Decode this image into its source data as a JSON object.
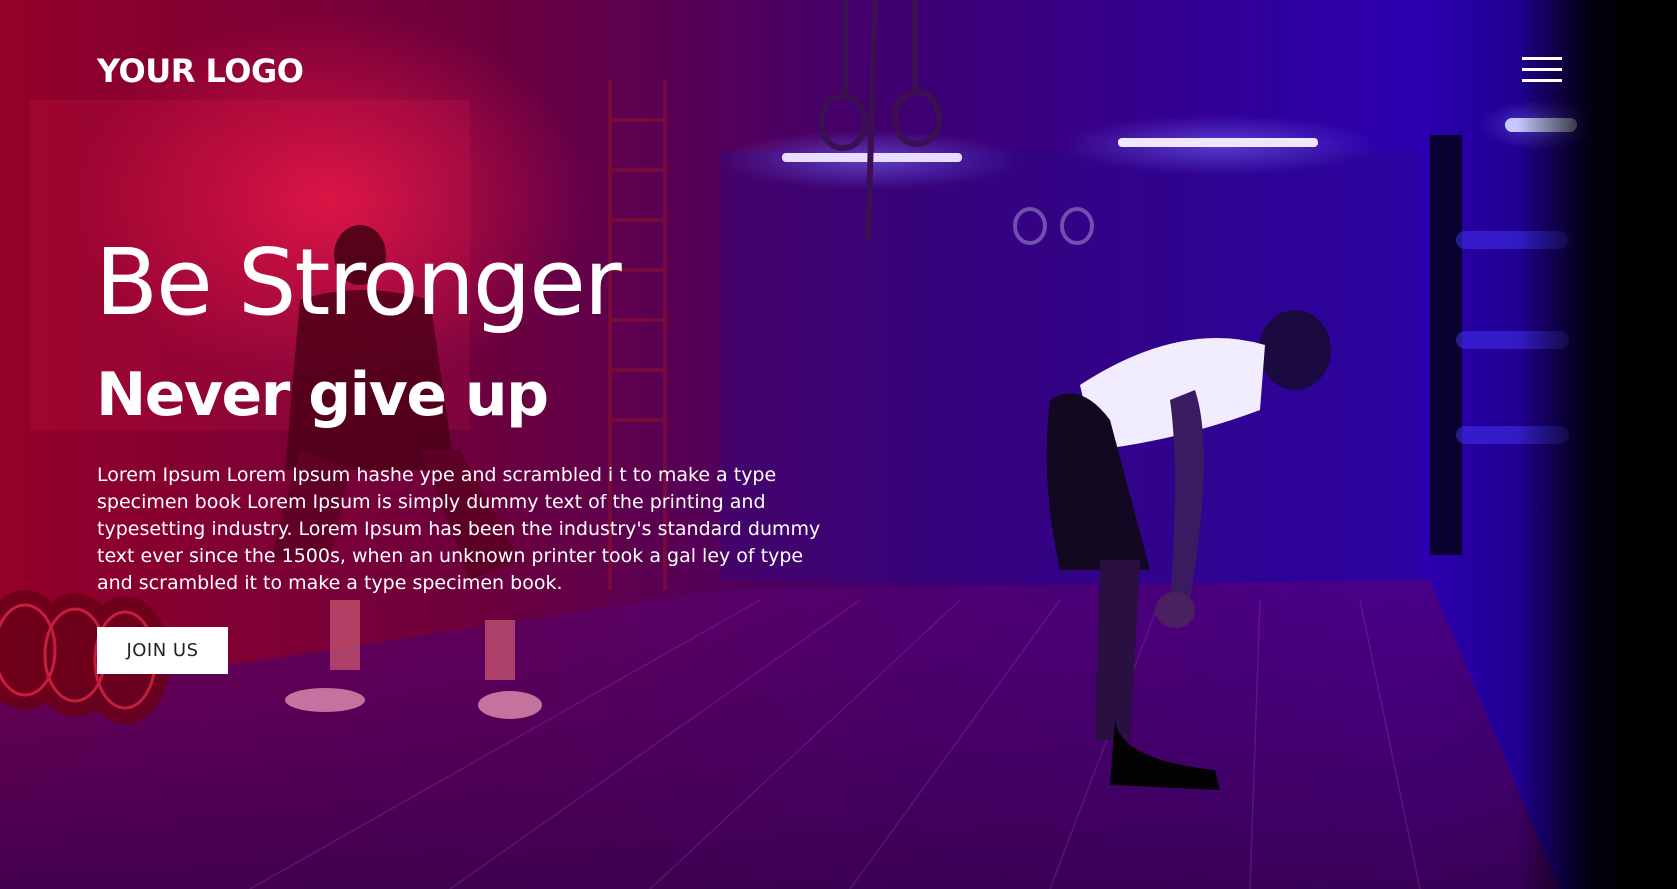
{
  "header": {
    "logo_text": "YOUR LOGO",
    "menu_icon": "hamburger-menu-icon"
  },
  "hero": {
    "headline": "Be Stronger",
    "subheadline": "Never give up",
    "body": "Lorem Ipsum Lorem Ipsum hashe ype and scrambled i t to make a type specimen book Lorem Ipsum is simply dummy text of the printing and typesetting industry. Lorem Ipsum has been the industry's standard dummy text ever since the 1500s, when an unknown printer took a gal ley of type and scrambled it to make a type specimen book.",
    "cta_label": "JOIN US"
  },
  "colors": {
    "accent_red": "#c8002a",
    "accent_violet": "#5a00ff",
    "text": "#ffffff"
  }
}
